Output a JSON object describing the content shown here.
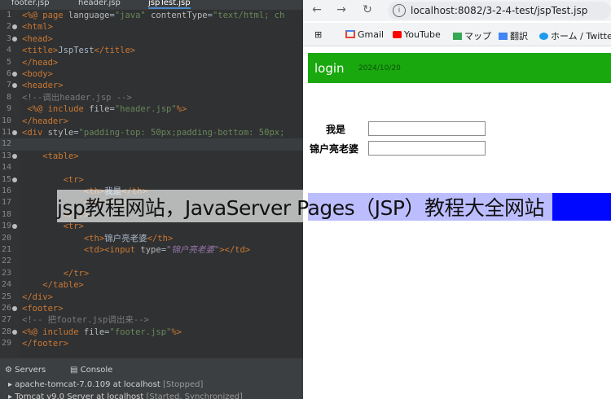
{
  "ide": {
    "tabs": [
      "footer.jsp",
      "header.jsp",
      "jspTest.jsp"
    ],
    "lines": [
      {
        "n": "1",
        "segs": [
          {
            "t": "<%@ ",
            "c": "t"
          },
          {
            "t": "page ",
            "c": "t"
          },
          {
            "t": "language",
            "c": "a"
          },
          {
            "t": "=",
            "c": "p"
          },
          {
            "t": "\"java\" ",
            "c": "s"
          },
          {
            "t": "contentType",
            "c": "a"
          },
          {
            "t": "=",
            "c": "p"
          },
          {
            "t": "\"text/html; ch",
            "c": "s"
          }
        ]
      },
      {
        "n": "2",
        "segs": [
          {
            "t": "<html>",
            "c": "t"
          }
        ]
      },
      {
        "n": "3",
        "segs": [
          {
            "t": "<head>",
            "c": "t"
          }
        ]
      },
      {
        "n": "4",
        "segs": [
          {
            "t": "<title>",
            "c": "t"
          },
          {
            "t": "JspTest",
            "c": "p"
          },
          {
            "t": "</title>",
            "c": "t"
          }
        ]
      },
      {
        "n": "5",
        "segs": [
          {
            "t": "</head>",
            "c": "t"
          }
        ]
      },
      {
        "n": "6",
        "segs": [
          {
            "t": "<body>",
            "c": "t"
          }
        ]
      },
      {
        "n": "7",
        "segs": [
          {
            "t": "<header>",
            "c": "t"
          }
        ]
      },
      {
        "n": "8",
        "segs": [
          {
            "t": "<!--调出header.jsp -->",
            "c": "c"
          }
        ]
      },
      {
        "n": "9",
        "segs": [
          {
            "t": " <%@ ",
            "c": "t"
          },
          {
            "t": "include ",
            "c": "t"
          },
          {
            "t": "file",
            "c": "a"
          },
          {
            "t": "=",
            "c": "p"
          },
          {
            "t": "\"header.jsp\"",
            "c": "s"
          },
          {
            "t": "%>",
            "c": "t"
          }
        ]
      },
      {
        "n": "10",
        "segs": [
          {
            "t": "</header>",
            "c": "t"
          }
        ]
      },
      {
        "n": "11",
        "segs": [
          {
            "t": "<div ",
            "c": "t"
          },
          {
            "t": "style",
            "c": "a"
          },
          {
            "t": "=",
            "c": "p"
          },
          {
            "t": "\"padding-top: 50px;padding-bottom: 50px;",
            "c": "s"
          }
        ]
      },
      {
        "n": "12",
        "segs": []
      },
      {
        "n": "13",
        "segs": [
          {
            "t": "    <table>",
            "c": "t"
          }
        ]
      },
      {
        "n": "14",
        "segs": []
      },
      {
        "n": "15",
        "segs": [
          {
            "t": "        <tr>",
            "c": "t"
          }
        ]
      },
      {
        "n": "16",
        "segs": [
          {
            "t": "            <th>",
            "c": "t"
          },
          {
            "t": "我是",
            "c": "p"
          },
          {
            "t": "</th>",
            "c": "t"
          }
        ]
      },
      {
        "n": "17",
        "segs": [
          {
            "t": "            <td>",
            "c": "t"
          },
          {
            "t": "\"我是\"",
            "c": "s"
          }
        ]
      },
      {
        "n": "18",
        "segs": [
          {
            "t": "        </tr>",
            "c": "t"
          }
        ]
      },
      {
        "n": "19",
        "segs": [
          {
            "t": "        <tr>",
            "c": "t"
          }
        ]
      },
      {
        "n": "20",
        "segs": [
          {
            "t": "            <th>",
            "c": "t"
          },
          {
            "t": "锦户亮老婆",
            "c": "p"
          },
          {
            "t": "</th>",
            "c": "t"
          }
        ]
      },
      {
        "n": "21",
        "segs": [
          {
            "t": "            <td><input ",
            "c": "t"
          },
          {
            "t": "type",
            "c": "a"
          },
          {
            "t": "=",
            "c": "p"
          },
          {
            "t": "\"锦户亮老婆\"",
            "c": "i"
          },
          {
            "t": "></td>",
            "c": "t"
          }
        ]
      },
      {
        "n": "22",
        "segs": []
      },
      {
        "n": "23",
        "segs": [
          {
            "t": "        </tr>",
            "c": "t"
          }
        ]
      },
      {
        "n": "24",
        "segs": [
          {
            "t": "    </table>",
            "c": "t"
          }
        ]
      },
      {
        "n": "25",
        "segs": [
          {
            "t": "</div>",
            "c": "t"
          }
        ]
      },
      {
        "n": "26",
        "segs": [
          {
            "t": "<footer>",
            "c": "t"
          }
        ]
      },
      {
        "n": "27",
        "segs": [
          {
            "t": "<!-- 把footer.jsp调出来-->",
            "c": "c"
          }
        ]
      },
      {
        "n": "28",
        "segs": [
          {
            "t": "<%@ ",
            "c": "t"
          },
          {
            "t": "include ",
            "c": "t"
          },
          {
            "t": "file",
            "c": "a"
          },
          {
            "t": "=",
            "c": "p"
          },
          {
            "t": "\"footer.jsp\"",
            "c": "s"
          },
          {
            "t": "%>",
            "c": "t"
          }
        ]
      },
      {
        "n": "29",
        "segs": [
          {
            "t": "</footer>",
            "c": "t"
          }
        ]
      }
    ]
  },
  "console": {
    "tabs": [
      "Servers",
      "Console"
    ],
    "servers": [
      {
        "name": "apache-tomcat-7.0.109 at localhost",
        "status": "[Stopped]"
      },
      {
        "name": "Tomcat v9.0 Server at localhost",
        "status": "[Started, Synchronized]"
      }
    ]
  },
  "browser": {
    "url": "localhost:8082/3-2-4-test/jspTest.jsp",
    "bookmarks": [
      "Gmail",
      "YouTube",
      "マップ",
      "翻訳",
      "ホーム / Twitter"
    ],
    "header": {
      "login": "login",
      "date": "2024/10/20"
    },
    "form": {
      "label1": "我是",
      "label2": "锦户亮老婆"
    }
  },
  "watermark": "jsp教程网站，JavaServer Pages（JSP）教程大全网站",
  "colors": {
    "header_green": "#1aa80f",
    "footer_blue": "#0008ff"
  }
}
